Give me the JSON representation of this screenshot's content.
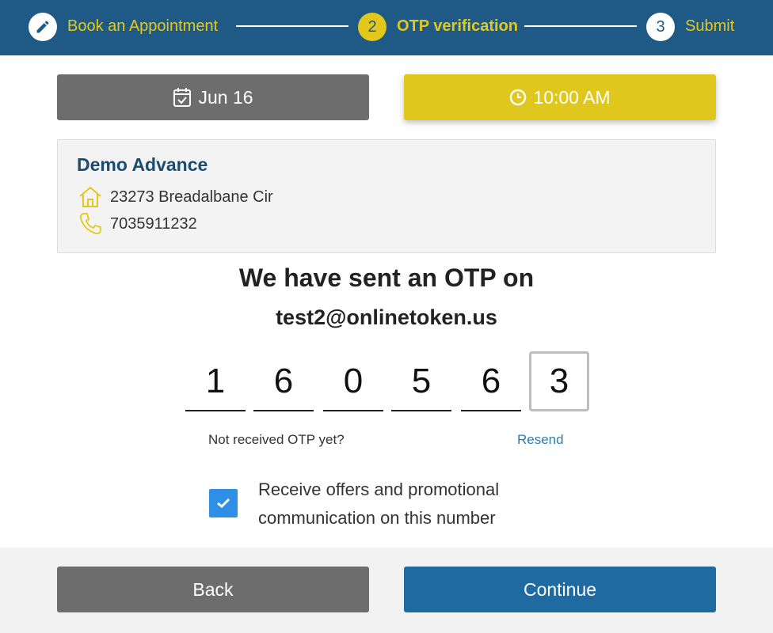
{
  "stepper": {
    "steps": [
      {
        "icon": "pencil-icon",
        "number": "",
        "label": "Book an Appointment"
      },
      {
        "icon": "",
        "number": "2",
        "label": "OTP verification"
      },
      {
        "icon": "",
        "number": "3",
        "label": "Submit"
      }
    ],
    "colors": {
      "bar": "#1f5a87",
      "accent": "#e3c81c"
    }
  },
  "appointment": {
    "date": "Jun 16",
    "date_icon": "calendar-check-icon",
    "time": "10:00 AM",
    "time_icon": "clock-icon"
  },
  "business": {
    "name": "Demo Advance",
    "address": "23273 Breadalbane Cir",
    "address_icon": "home-icon",
    "phone": "7035911232",
    "phone_icon": "phone-icon"
  },
  "otp": {
    "title": "We have sent an OTP on",
    "email": "test2@onlinetoken.us",
    "digits": [
      "1",
      "6",
      "0",
      "5",
      "6",
      "3"
    ],
    "active_index": 5,
    "not_received": "Not received OTP yet?",
    "resend": "Resend"
  },
  "consent": {
    "checked": true,
    "text": "Receive offers and promotional communication on this number"
  },
  "footer": {
    "back": "Back",
    "continue": "Continue"
  }
}
